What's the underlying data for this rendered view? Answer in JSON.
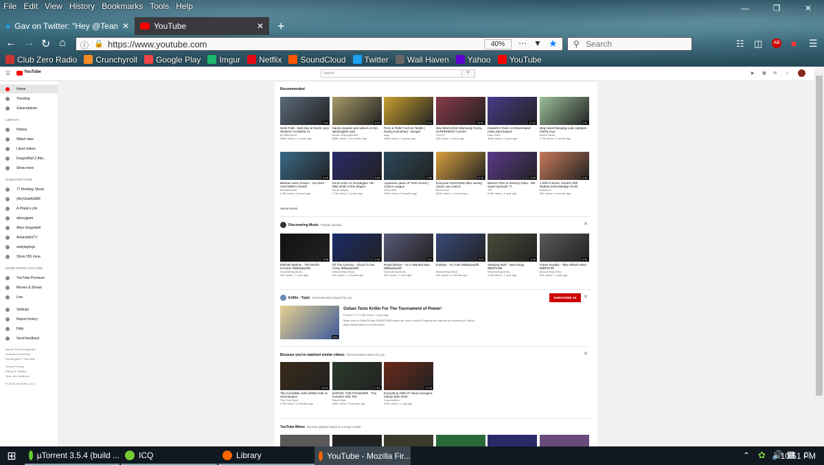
{
  "menubar": [
    "File",
    "Edit",
    "View",
    "History",
    "Bookmarks",
    "Tools",
    "Help"
  ],
  "tabs": [
    {
      "label": "Gav on Twitter: \"Hey @TeamYo",
      "icon": "twitter-icon"
    },
    {
      "label": "YouTube",
      "icon": "youtube-icon"
    }
  ],
  "nav": {
    "url": "https://www.youtube.com",
    "zoom": "40%",
    "search_placeholder": "Search"
  },
  "bookmarks": [
    {
      "label": "Club Zero Radio",
      "color": "#c33"
    },
    {
      "label": "Crunchyroll",
      "color": "#f78b24"
    },
    {
      "label": "Google Play",
      "color": "#e44"
    },
    {
      "label": "Imgur",
      "color": "#1bb76e"
    },
    {
      "label": "Netflix",
      "color": "#e50914"
    },
    {
      "label": "SoundCloud",
      "color": "#f50"
    },
    {
      "label": "Twitter",
      "color": "#1da1f2"
    },
    {
      "label": "Wall Haven",
      "color": "#666"
    },
    {
      "label": "Yahoo",
      "color": "#6001d2"
    },
    {
      "label": "YouTube",
      "color": "#f00"
    }
  ],
  "yt": {
    "logo": "YouTube",
    "search_placeholder": "Search",
    "sidebar": {
      "top": [
        "Home",
        "Trending",
        "Subscriptions"
      ],
      "library_h": "LIBRARY",
      "library": [
        "History",
        "Watch later",
        "Liked videos",
        "DragonBall Z Abri...",
        "Show more"
      ],
      "subs_h": "SUBSCRIPTIONS",
      "subs": [
        "77 Bombay Street",
        "(Re)VisleASMR",
        "A Pirate's Life",
        "abneyjpark",
        "Aline Gingerbell",
        "AmaranthsTV",
        "andytaylorja",
        "Show 255 more"
      ],
      "more_h": "MORE FROM YOUTUBE",
      "more": [
        "YouTube Premium",
        "Movies & Shows",
        "Live"
      ],
      "settings": [
        "Settings",
        "Report history",
        "Help",
        "Send feedback"
      ],
      "footer": [
        "About  Press  Copyright",
        "Creators  Advertise",
        "Developers  +YouTube",
        "Terms  Privacy",
        "Policy & Safety",
        "Test new features",
        "© 2018 YouTube, LLC"
      ]
    },
    "recommended_h": "Recommended",
    "show_more": "SHOW MORE",
    "rec_row1": [
      {
        "t": "Work Fails - Bad Day at Work! Lazy Workers' Accidents At",
        "c": "Mr BBySpoon",
        "v": "958K views • 1 month ago",
        "d": "9:42",
        "col": "#5a6a7a"
      },
      {
        "t": "Naruto,Sasuke and sakura vs ten tails(english sub)",
        "c": "Naruto Shippuden567",
        "v": "858K views • 10 months ago",
        "d": "9:51",
        "col": "#a89a6a"
      },
      {
        "t": "Penn & Teller Fool Us TanBA | Eating everything - Danger",
        "c": "shay",
        "v": "298K views • 3 weeks ago",
        "d": "8:11",
        "col": "#c8a030"
      },
      {
        "t": "New Meet 2018 Hilariously Funny SUPERHERO Comics",
        "c": "Funn17",
        "v": "184 views • 1 week ago",
        "d": "10:04",
        "col": "#8a3a4a"
      },
      {
        "t": "Kakashi's Team vs Reanimated Haku,Sanl,sakura",
        "c": "Dark 3003",
        "v": "359K views • 1 year ago",
        "d": "11:22",
        "col": "#4a3a8a"
      },
      {
        "t": "Meg Heard Banging Luke Upstairs Family Guy",
        "c": "Racell Sama",
        "v": "1.7M views • 2 weeks ago",
        "d": "2:32",
        "col": "#9abf9a"
      }
    ],
    "rec_row2": [
      {
        "t": "Batman owns Amazo - You don't need MERA (Greek",
        "c": "thebatmonder",
        "v": "2.9M views • 6 years ago",
        "d": "3:18",
        "col": "#3a6a8a"
      },
      {
        "t": "SSJ3 Goku Vs Hirudegarn HD - DBZ wrath of the dragon",
        "c": "Super Saiyan",
        "v": "1.7M views • 3 years ago",
        "d": "3:40",
        "col": "#2a2a6a"
      },
      {
        "t": "Aquaman Lasso of Truth Scene | Justice League",
        "c": "Filmic Box",
        "v": "995K views • 6 months ago",
        "d": "0:39",
        "col": "#2a4a5a"
      },
      {
        "t": "Everyone SHOCKED after seeing naruto can control",
        "c": "Boruto Kun",
        "v": "531K views • 1 month ago",
        "d": "2:16",
        "col": "#d8a040"
      },
      {
        "t": "Beerus Tries to Destroy Goku - DB Super Episode 77",
        "c": "TKL",
        "v": "6.8M views • 1 year ago",
        "d": "5:08",
        "col": "#5a3a8a"
      },
      {
        "t": "A Will of Stone, Onoki's Will, Madara acknowledge Onoki",
        "c": "Madara S",
        "v": "59K views • 6 months ago",
        "d": "3:40",
        "col": "#c87a5a"
      }
    ],
    "dm": {
      "title": "Discovering Music",
      "sub": "Popular uploads"
    },
    "dm_row": [
      {
        "t": "Mitchell Marlow - The Devil's Knockin' ꟿBadassꟿ",
        "c": "Discovering Music",
        "v": "99K views • 1 year ago",
        "d": "3:38",
        "col": "#111"
      },
      {
        "t": "Oh The Larceny - About To Get Crazy ꟿBadassꟿ",
        "c": "Discovering Music",
        "v": "51K views • 2 months ago",
        "d": "2:44",
        "col": "#1a2a6a"
      },
      {
        "t": "Royal Deluxe - I'm A Wanted Man ꟿBadassꟿ",
        "c": "Discovering Music",
        "v": "63K views • 1 year ago",
        "d": "2:47",
        "col": "#5a5a7a"
      },
      {
        "t": "Endway - Go Fast ꟿBadassꟿ",
        "c": "Discovering Music",
        "v": "41K views • 6 months ago",
        "d": "3:20",
        "col": "#3a4a7a"
      },
      {
        "t": "Sleeping Wolf - New Kings ꟿEPICꟿ",
        "c": "Discovering Music",
        "v": "4.5M views • 1 year ago",
        "d": "3:40",
        "col": "#4a4a3a"
      },
      {
        "t": "Future Royalty - Take What's Mine ꟿEPICꟿ",
        "c": "Discovering Music",
        "v": "87K views • 1 year ago",
        "d": "3:34",
        "col": "#5a5a5a"
      }
    ],
    "krillin": {
      "channel": "Krillin - Topic",
      "sub": "Recommended channel for you",
      "subscribe": "SUBSCRIBE 1K",
      "title": "Gohan Tests Krillin For The Tournament of Power!",
      "meta": "Funnan TV • 2.3M views • 1 year ago",
      "desc": "Make sure to SMASH that SUBSCRIBE button for more content! Support the channel by becoming a Patron - https://www.patreon.com/funnantv",
      "d": "8:51"
    },
    "similar": {
      "title": "Because you've watched similar videos",
      "sub": "Recommended videos for you"
    },
    "sim_row": [
      {
        "t": "The Incredible Hulk (2008) Hulk vs Abomination",
        "c": "The Grey Spot",
        "v": "2.5M views • 8 months ago",
        "d": "12:04",
        "col": "#3a2a1a"
      },
      {
        "t": "MARVEL THE PUNISHER - The Punisher Kills The",
        "c": "PlanetClips",
        "v": "358K views • 8 months ago",
        "d": "1:51",
        "col": "#2a3a2a"
      },
      {
        "t": "Everything GREAT About Avengers: Infinity War! (Part",
        "c": "CinemaWins",
        "v": "919K views • 1 day ago",
        "d": "17:45",
        "col": "#6a2a1a"
      }
    ],
    "mixes": {
      "title": "YouTube Mixes",
      "sub": "Nonstop playlists based on a song or artist"
    }
  },
  "taskbar": [
    {
      "label": "µTorrent 3.5.4  (build ...",
      "color": "#6c3"
    },
    {
      "label": "ICQ",
      "color": "#7c3"
    },
    {
      "label": "Library",
      "color": "#f60"
    },
    {
      "label": "YouTube - Mozilla Fir...",
      "color": "#f60"
    }
  ],
  "clock": "10:51 PM"
}
